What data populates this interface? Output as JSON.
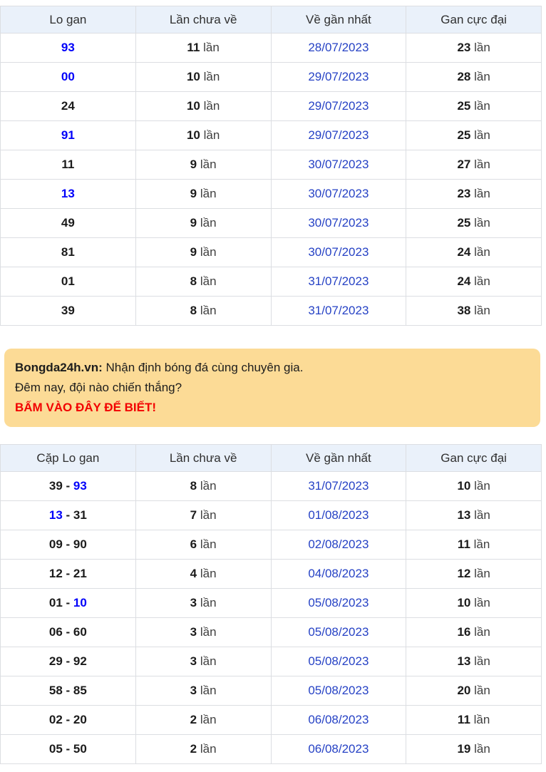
{
  "colors": {
    "blue_number": "#0000fa",
    "date_blue": "#2642c5",
    "header_bg": "#eaf1fa",
    "border": "#dcdee2",
    "banner_bg": "#fcdb96",
    "cta_red": "#f20000",
    "text_dark": "#222222",
    "unit_text": "#3f3f3f"
  },
  "units": {
    "lan": "lần"
  },
  "table_gan": {
    "headers": [
      "Lo gan",
      "Lần chưa về",
      "Về gần nhất",
      "Gan cực đại"
    ],
    "rows": [
      {
        "number": "93",
        "number_blue": true,
        "missed": "11",
        "last_date": "28/07/2023",
        "max": "23"
      },
      {
        "number": "00",
        "number_blue": true,
        "missed": "10",
        "last_date": "29/07/2023",
        "max": "28"
      },
      {
        "number": "24",
        "number_blue": false,
        "missed": "10",
        "last_date": "29/07/2023",
        "max": "25"
      },
      {
        "number": "91",
        "number_blue": true,
        "missed": "10",
        "last_date": "29/07/2023",
        "max": "25"
      },
      {
        "number": "11",
        "number_blue": false,
        "missed": "9",
        "last_date": "30/07/2023",
        "max": "27"
      },
      {
        "number": "13",
        "number_blue": true,
        "missed": "9",
        "last_date": "30/07/2023",
        "max": "23"
      },
      {
        "number": "49",
        "number_blue": false,
        "missed": "9",
        "last_date": "30/07/2023",
        "max": "25"
      },
      {
        "number": "81",
        "number_blue": false,
        "missed": "9",
        "last_date": "30/07/2023",
        "max": "24"
      },
      {
        "number": "01",
        "number_blue": false,
        "missed": "8",
        "last_date": "31/07/2023",
        "max": "24"
      },
      {
        "number": "39",
        "number_blue": false,
        "missed": "8",
        "last_date": "31/07/2023",
        "max": "38"
      }
    ]
  },
  "banner": {
    "brand": "Bongda24h.vn:",
    "line1": " Nhận định bóng đá cùng chuyên gia.",
    "line2": "Đêm nay, đội nào chiến thắng?",
    "cta": "BẤM VÀO ĐÂY ĐỂ BIẾT!"
  },
  "table_pairs": {
    "headers": [
      "Cặp Lo gan",
      "Lần chưa về",
      "Về gần nhất",
      "Gan cực đại"
    ],
    "rows": [
      {
        "p1": "39",
        "p1_blue": false,
        "sep": " - ",
        "p2": "93",
        "p2_blue": true,
        "missed": "8",
        "last_date": "31/07/2023",
        "max": "10"
      },
      {
        "p1": "13",
        "p1_blue": true,
        "sep": " - ",
        "p2": "31",
        "p2_blue": false,
        "missed": "7",
        "last_date": "01/08/2023",
        "max": "13"
      },
      {
        "p1": "09",
        "p1_blue": false,
        "sep": " - ",
        "p2": "90",
        "p2_blue": false,
        "missed": "6",
        "last_date": "02/08/2023",
        "max": "11"
      },
      {
        "p1": "12",
        "p1_blue": false,
        "sep": " - ",
        "p2": "21",
        "p2_blue": false,
        "missed": "4",
        "last_date": "04/08/2023",
        "max": "12"
      },
      {
        "p1": "01",
        "p1_blue": false,
        "sep": " - ",
        "p2": "10",
        "p2_blue": true,
        "missed": "3",
        "last_date": "05/08/2023",
        "max": "10"
      },
      {
        "p1": "06",
        "p1_blue": false,
        "sep": " - ",
        "p2": "60",
        "p2_blue": false,
        "missed": "3",
        "last_date": "05/08/2023",
        "max": "16"
      },
      {
        "p1": "29",
        "p1_blue": false,
        "sep": " - ",
        "p2": "92",
        "p2_blue": false,
        "missed": "3",
        "last_date": "05/08/2023",
        "max": "13"
      },
      {
        "p1": "58",
        "p1_blue": false,
        "sep": " - ",
        "p2": "85",
        "p2_blue": false,
        "missed": "3",
        "last_date": "05/08/2023",
        "max": "20"
      },
      {
        "p1": "02",
        "p1_blue": false,
        "sep": " - ",
        "p2": "20",
        "p2_blue": false,
        "missed": "2",
        "last_date": "06/08/2023",
        "max": "11"
      },
      {
        "p1": "05",
        "p1_blue": false,
        "sep": " - ",
        "p2": "50",
        "p2_blue": false,
        "missed": "2",
        "last_date": "06/08/2023",
        "max": "19"
      }
    ]
  }
}
